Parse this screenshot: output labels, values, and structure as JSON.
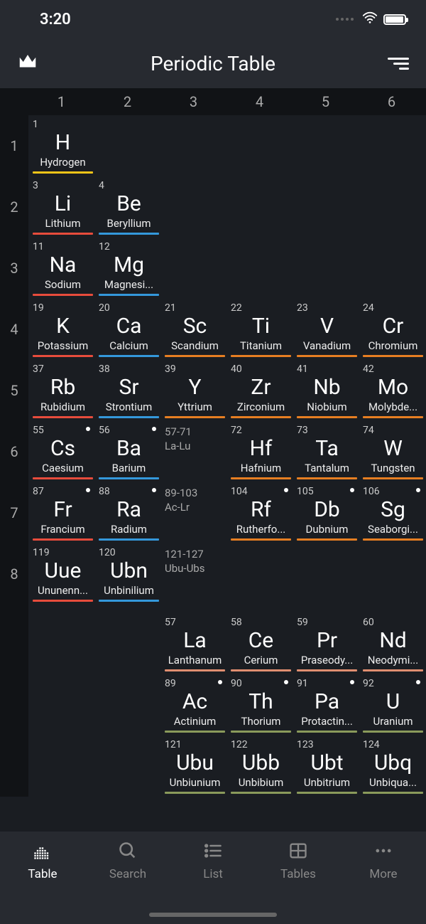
{
  "status": {
    "time": "3:20"
  },
  "header": {
    "title": "Periodic Table"
  },
  "columns": [
    "1",
    "2",
    "3",
    "4",
    "5",
    "6"
  ],
  "periods": [
    "1",
    "2",
    "3",
    "4",
    "5",
    "6",
    "7",
    "8"
  ],
  "colors": {
    "alkali": "#e74c3c",
    "alkaline": "#3498db",
    "transition": "#e67e22",
    "nonmetal": "#f5c518",
    "lanthanide": "#e08e70",
    "actinide": "#8a9a5b"
  },
  "rows": [
    {
      "period": "1",
      "cells": [
        {
          "num": "1",
          "sym": "H",
          "name": "Hydrogen",
          "color": "yellow"
        }
      ]
    },
    {
      "period": "2",
      "cells": [
        {
          "num": "3",
          "sym": "Li",
          "name": "Lithium",
          "color": "red"
        },
        {
          "num": "4",
          "sym": "Be",
          "name": "Beryllium",
          "color": "blue"
        }
      ]
    },
    {
      "period": "3",
      "cells": [
        {
          "num": "11",
          "sym": "Na",
          "name": "Sodium",
          "color": "red"
        },
        {
          "num": "12",
          "sym": "Mg",
          "name": "Magnesium",
          "display_name": "Magnesi...",
          "color": "blue"
        }
      ]
    },
    {
      "period": "4",
      "cells": [
        {
          "num": "19",
          "sym": "K",
          "name": "Potassium",
          "color": "red"
        },
        {
          "num": "20",
          "sym": "Ca",
          "name": "Calcium",
          "color": "blue"
        },
        {
          "num": "21",
          "sym": "Sc",
          "name": "Scandium",
          "color": "orange"
        },
        {
          "num": "22",
          "sym": "Ti",
          "name": "Titanium",
          "color": "orange"
        },
        {
          "num": "23",
          "sym": "V",
          "name": "Vanadium",
          "color": "orange"
        },
        {
          "num": "24",
          "sym": "Cr",
          "name": "Chromium",
          "color": "orange"
        }
      ]
    },
    {
      "period": "5",
      "cells": [
        {
          "num": "37",
          "sym": "Rb",
          "name": "Rubidium",
          "color": "red"
        },
        {
          "num": "38",
          "sym": "Sr",
          "name": "Strontium",
          "color": "blue"
        },
        {
          "num": "39",
          "sym": "Y",
          "name": "Yttrium",
          "color": "orange"
        },
        {
          "num": "40",
          "sym": "Zr",
          "name": "Zirconium",
          "color": "orange"
        },
        {
          "num": "41",
          "sym": "Nb",
          "name": "Niobium",
          "color": "orange"
        },
        {
          "num": "42",
          "sym": "Mo",
          "name": "Molybdenum",
          "display_name": "Molybde...",
          "color": "orange"
        }
      ]
    },
    {
      "period": "6",
      "cells": [
        {
          "num": "55",
          "sym": "Cs",
          "name": "Caesium",
          "color": "red",
          "dot": true
        },
        {
          "num": "56",
          "sym": "Ba",
          "name": "Barium",
          "color": "blue",
          "dot": true
        },
        {
          "range": "57-71",
          "range_sym": "La-Lu"
        },
        {
          "num": "72",
          "sym": "Hf",
          "name": "Hafnium",
          "color": "orange"
        },
        {
          "num": "73",
          "sym": "Ta",
          "name": "Tantalum",
          "color": "orange"
        },
        {
          "num": "74",
          "sym": "W",
          "name": "Tungsten",
          "color": "orange"
        }
      ]
    },
    {
      "period": "7",
      "cells": [
        {
          "num": "87",
          "sym": "Fr",
          "name": "Francium",
          "color": "red",
          "dot": true
        },
        {
          "num": "88",
          "sym": "Ra",
          "name": "Radium",
          "color": "blue",
          "dot": true
        },
        {
          "range": "89-103",
          "range_sym": "Ac-Lr"
        },
        {
          "num": "104",
          "sym": "Rf",
          "name": "Rutherfordium",
          "display_name": "Rutherfo...",
          "color": "orange",
          "dot": true
        },
        {
          "num": "105",
          "sym": "Db",
          "name": "Dubnium",
          "color": "orange",
          "dot": true
        },
        {
          "num": "106",
          "sym": "Sg",
          "name": "Seaborgium",
          "display_name": "Seaborgi...",
          "color": "orange",
          "dot": true
        }
      ]
    },
    {
      "period": "8",
      "cells": [
        {
          "num": "119",
          "sym": "Uue",
          "name": "Ununennium",
          "display_name": "Ununenn...",
          "color": "red"
        },
        {
          "num": "120",
          "sym": "Ubn",
          "name": "Unbinilium",
          "color": "blue"
        },
        {
          "range": "121-127",
          "range_sym": "Ubu-Ubs"
        }
      ]
    }
  ],
  "extra_rows": [
    {
      "offset": 2,
      "cells": [
        {
          "num": "57",
          "sym": "La",
          "name": "Lanthanum",
          "color": "coral"
        },
        {
          "num": "58",
          "sym": "Ce",
          "name": "Cerium",
          "color": "coral"
        },
        {
          "num": "59",
          "sym": "Pr",
          "name": "Praseodymium",
          "display_name": "Praseody...",
          "color": "coral"
        },
        {
          "num": "60",
          "sym": "Nd",
          "name": "Neodymium",
          "display_name": "Neodymi...",
          "color": "coral"
        }
      ]
    },
    {
      "offset": 2,
      "cells": [
        {
          "num": "89",
          "sym": "Ac",
          "name": "Actinium",
          "color": "olive",
          "dot": true
        },
        {
          "num": "90",
          "sym": "Th",
          "name": "Thorium",
          "color": "olive",
          "dot": true
        },
        {
          "num": "91",
          "sym": "Pa",
          "name": "Protactinium",
          "display_name": "Protactin...",
          "color": "olive",
          "dot": true
        },
        {
          "num": "92",
          "sym": "U",
          "name": "Uranium",
          "color": "olive",
          "dot": true
        }
      ]
    },
    {
      "offset": 2,
      "cells": [
        {
          "num": "121",
          "sym": "Ubu",
          "name": "Unbiunium",
          "color": "olive"
        },
        {
          "num": "122",
          "sym": "Ubb",
          "name": "Unbibium",
          "color": "olive"
        },
        {
          "num": "123",
          "sym": "Ubt",
          "name": "Unbitrium",
          "color": "olive"
        },
        {
          "num": "124",
          "sym": "Ubq",
          "name": "Unbiquadium",
          "display_name": "Unbiqua...",
          "color": "olive"
        }
      ]
    }
  ],
  "nav": [
    {
      "key": "table",
      "label": "Table",
      "active": true
    },
    {
      "key": "search",
      "label": "Search",
      "active": false
    },
    {
      "key": "list",
      "label": "List",
      "active": false
    },
    {
      "key": "tables",
      "label": "Tables",
      "active": false
    },
    {
      "key": "more",
      "label": "More",
      "active": false
    }
  ]
}
